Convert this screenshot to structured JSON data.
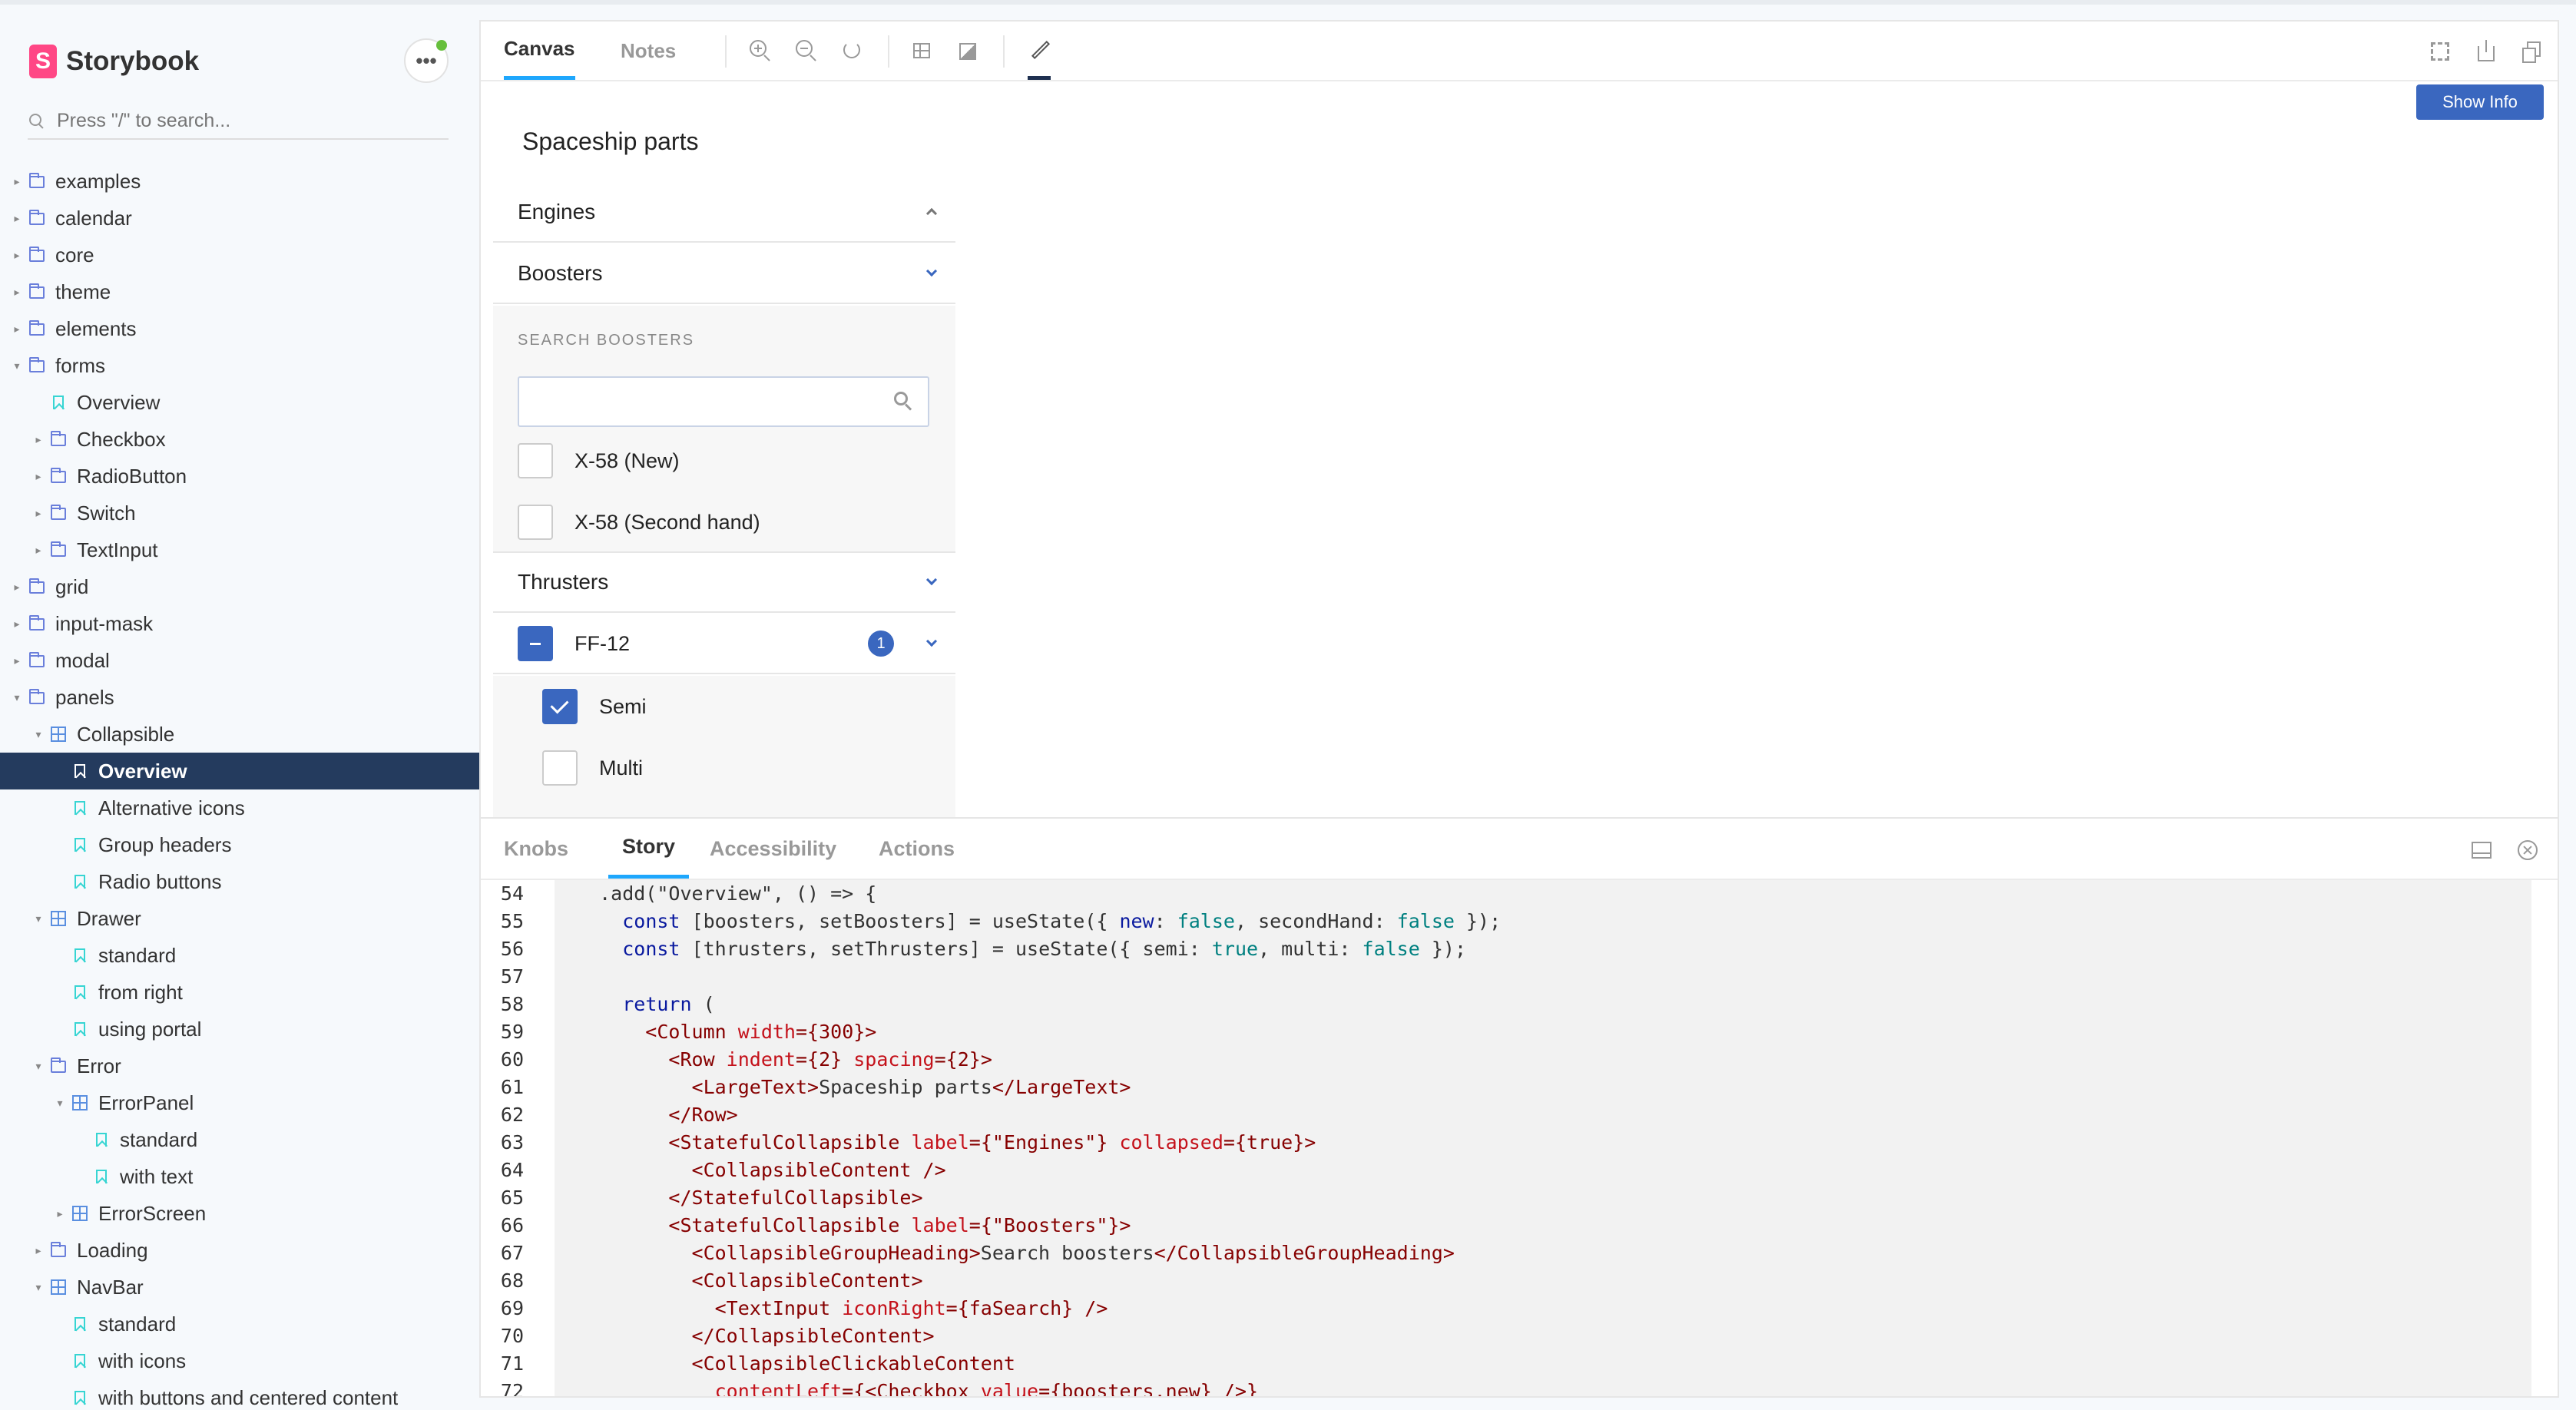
{
  "app": {
    "name": "Storybook",
    "logo_letter": "S",
    "menu_label": "•••"
  },
  "search": {
    "placeholder": "Press \"/\" to search..."
  },
  "sidebar": {
    "items": [
      {
        "label": "examples",
        "type": "folder",
        "level": 0,
        "caret": "▸"
      },
      {
        "label": "calendar",
        "type": "folder",
        "level": 0,
        "caret": "▸"
      },
      {
        "label": "core",
        "type": "folder",
        "level": 0,
        "caret": "▸"
      },
      {
        "label": "theme",
        "type": "folder",
        "level": 0,
        "caret": "▸"
      },
      {
        "label": "elements",
        "type": "folder",
        "level": 0,
        "caret": "▸"
      },
      {
        "label": "forms",
        "type": "folder",
        "level": 0,
        "caret": "▾"
      },
      {
        "label": "Overview",
        "type": "story",
        "level": 1,
        "caret": ""
      },
      {
        "label": "Checkbox",
        "type": "folder",
        "level": 1,
        "caret": "▸"
      },
      {
        "label": "RadioButton",
        "type": "folder",
        "level": 1,
        "caret": "▸"
      },
      {
        "label": "Switch",
        "type": "folder",
        "level": 1,
        "caret": "▸"
      },
      {
        "label": "TextInput",
        "type": "folder",
        "level": 1,
        "caret": "▸"
      },
      {
        "label": "grid",
        "type": "folder",
        "level": 0,
        "caret": "▸"
      },
      {
        "label": "input-mask",
        "type": "folder",
        "level": 0,
        "caret": "▸"
      },
      {
        "label": "modal",
        "type": "folder",
        "level": 0,
        "caret": "▸"
      },
      {
        "label": "panels",
        "type": "folder",
        "level": 0,
        "caret": "▾"
      },
      {
        "label": "Collapsible",
        "type": "component",
        "level": 1,
        "caret": "▾"
      },
      {
        "label": "Overview",
        "type": "story",
        "level": 2,
        "caret": "",
        "selected": true
      },
      {
        "label": "Alternative icons",
        "type": "story",
        "level": 2,
        "caret": ""
      },
      {
        "label": "Group headers",
        "type": "story",
        "level": 2,
        "caret": ""
      },
      {
        "label": "Radio buttons",
        "type": "story",
        "level": 2,
        "caret": ""
      },
      {
        "label": "Drawer",
        "type": "component",
        "level": 1,
        "caret": "▾"
      },
      {
        "label": "standard",
        "type": "story",
        "level": 2,
        "caret": ""
      },
      {
        "label": "from right",
        "type": "story",
        "level": 2,
        "caret": ""
      },
      {
        "label": "using portal",
        "type": "story",
        "level": 2,
        "caret": ""
      },
      {
        "label": "Error",
        "type": "folder",
        "level": 1,
        "caret": "▾"
      },
      {
        "label": "ErrorPanel",
        "type": "component",
        "level": 2,
        "caret": "▾"
      },
      {
        "label": "standard",
        "type": "story",
        "level": 3,
        "caret": ""
      },
      {
        "label": "with text",
        "type": "story",
        "level": 3,
        "caret": ""
      },
      {
        "label": "ErrorScreen",
        "type": "component",
        "level": 2,
        "caret": "▸"
      },
      {
        "label": "Loading",
        "type": "folder",
        "level": 1,
        "caret": "▸"
      },
      {
        "label": "NavBar",
        "type": "component",
        "level": 1,
        "caret": "▾"
      },
      {
        "label": "standard",
        "type": "story",
        "level": 2,
        "caret": ""
      },
      {
        "label": "with icons",
        "type": "story",
        "level": 2,
        "caret": ""
      },
      {
        "label": "with buttons and centered content",
        "type": "story",
        "level": 2,
        "caret": ""
      }
    ]
  },
  "toolbar": {
    "tabs": [
      {
        "label": "Canvas",
        "active": true
      },
      {
        "label": "Notes",
        "active": false
      }
    ],
    "show_info_label": "Show Info"
  },
  "canvas": {
    "title": "Spaceship parts",
    "engines": {
      "label": "Engines",
      "collapsed": true
    },
    "boosters": {
      "label": "Boosters",
      "group_heading": "SEARCH BOOSTERS",
      "search_value": "",
      "options": [
        {
          "label": "X-58 (New)",
          "checked": false
        },
        {
          "label": "X-58 (Second hand)",
          "checked": false
        }
      ]
    },
    "thrusters": {
      "label": "Thrusters",
      "group": {
        "label": "FF-12",
        "badge": "1",
        "state": "mixed"
      },
      "options": [
        {
          "label": "Semi",
          "checked": true
        },
        {
          "label": "Multi",
          "checked": false
        }
      ]
    }
  },
  "addons": {
    "tabs": [
      {
        "label": "Knobs",
        "active": false
      },
      {
        "label": "Story",
        "active": true
      },
      {
        "label": "Accessibility",
        "active": false
      },
      {
        "label": "Actions",
        "active": false
      }
    ]
  },
  "code": {
    "lines": [
      {
        "n": "54",
        "tokens": [
          {
            "t": "  .add(\"Overview\", () => {",
            "c": "val"
          }
        ]
      },
      {
        "n": "55",
        "tokens": [
          {
            "t": "    ",
            "c": "val"
          },
          {
            "t": "const",
            "c": "kw"
          },
          {
            "t": " [boosters, setBoosters] = useState({ ",
            "c": "val"
          },
          {
            "t": "new",
            "c": "kw"
          },
          {
            "t": ": ",
            "c": "val"
          },
          {
            "t": "false",
            "c": "bool"
          },
          {
            "t": ", secondHand: ",
            "c": "val"
          },
          {
            "t": "false",
            "c": "bool"
          },
          {
            "t": " });",
            "c": "val"
          }
        ]
      },
      {
        "n": "56",
        "tokens": [
          {
            "t": "    ",
            "c": "val"
          },
          {
            "t": "const",
            "c": "kw"
          },
          {
            "t": " [thrusters, setThrusters] = useState({ semi: ",
            "c": "val"
          },
          {
            "t": "true",
            "c": "bool"
          },
          {
            "t": ", multi: ",
            "c": "val"
          },
          {
            "t": "false",
            "c": "bool"
          },
          {
            "t": " });",
            "c": "val"
          }
        ]
      },
      {
        "n": "57",
        "tokens": []
      },
      {
        "n": "58",
        "tokens": [
          {
            "t": "    ",
            "c": "val"
          },
          {
            "t": "return",
            "c": "kw"
          },
          {
            "t": " (",
            "c": "val"
          }
        ]
      },
      {
        "n": "59",
        "tokens": [
          {
            "t": "      <Column ",
            "c": "tag"
          },
          {
            "t": "width",
            "c": "attr"
          },
          {
            "t": "={300}>",
            "c": "tag"
          }
        ]
      },
      {
        "n": "60",
        "tokens": [
          {
            "t": "        <Row ",
            "c": "tag"
          },
          {
            "t": "indent",
            "c": "attr"
          },
          {
            "t": "={2} ",
            "c": "tag"
          },
          {
            "t": "spacing",
            "c": "attr"
          },
          {
            "t": "={2}>",
            "c": "tag"
          }
        ]
      },
      {
        "n": "61",
        "tokens": [
          {
            "t": "          <LargeText>",
            "c": "tag"
          },
          {
            "t": "Spaceship parts",
            "c": "val"
          },
          {
            "t": "</LargeText>",
            "c": "tag"
          }
        ]
      },
      {
        "n": "62",
        "tokens": [
          {
            "t": "        </Row>",
            "c": "tag"
          }
        ]
      },
      {
        "n": "63",
        "tokens": [
          {
            "t": "        <StatefulCollapsible ",
            "c": "tag"
          },
          {
            "t": "label",
            "c": "attr"
          },
          {
            "t": "={\"Engines\"} ",
            "c": "tag"
          },
          {
            "t": "collapsed",
            "c": "attr"
          },
          {
            "t": "={true}>",
            "c": "tag"
          }
        ]
      },
      {
        "n": "64",
        "tokens": [
          {
            "t": "          <CollapsibleContent />",
            "c": "tag"
          }
        ]
      },
      {
        "n": "65",
        "tokens": [
          {
            "t": "        </StatefulCollapsible>",
            "c": "tag"
          }
        ]
      },
      {
        "n": "66",
        "tokens": [
          {
            "t": "        <StatefulCollapsible ",
            "c": "tag"
          },
          {
            "t": "label",
            "c": "attr"
          },
          {
            "t": "={\"Boosters\"}>",
            "c": "tag"
          }
        ]
      },
      {
        "n": "67",
        "tokens": [
          {
            "t": "          <CollapsibleGroupHeading>",
            "c": "tag"
          },
          {
            "t": "Search boosters",
            "c": "val"
          },
          {
            "t": "</CollapsibleGroupHeading>",
            "c": "tag"
          }
        ]
      },
      {
        "n": "68",
        "tokens": [
          {
            "t": "          <CollapsibleContent>",
            "c": "tag"
          }
        ]
      },
      {
        "n": "69",
        "tokens": [
          {
            "t": "            <TextInput ",
            "c": "tag"
          },
          {
            "t": "iconRight",
            "c": "attr"
          },
          {
            "t": "={faSearch} />",
            "c": "tag"
          }
        ]
      },
      {
        "n": "70",
        "tokens": [
          {
            "t": "          </CollapsibleContent>",
            "c": "tag"
          }
        ]
      },
      {
        "n": "71",
        "tokens": [
          {
            "t": "          <CollapsibleClickableContent",
            "c": "tag"
          }
        ]
      },
      {
        "n": "72",
        "tokens": [
          {
            "t": "            ",
            "c": "val"
          },
          {
            "t": "contentLeft",
            "c": "attr"
          },
          {
            "t": "={<Checkbox ",
            "c": "tag"
          },
          {
            "t": "value",
            "c": "attr"
          },
          {
            "t": "={boosters.new} />}",
            "c": "tag"
          }
        ]
      }
    ]
  },
  "colors": {
    "accent": "#1ea7fd",
    "primary": "#3a67bf",
    "selected_bg": "#243b5e",
    "brand": "#ff4785"
  }
}
